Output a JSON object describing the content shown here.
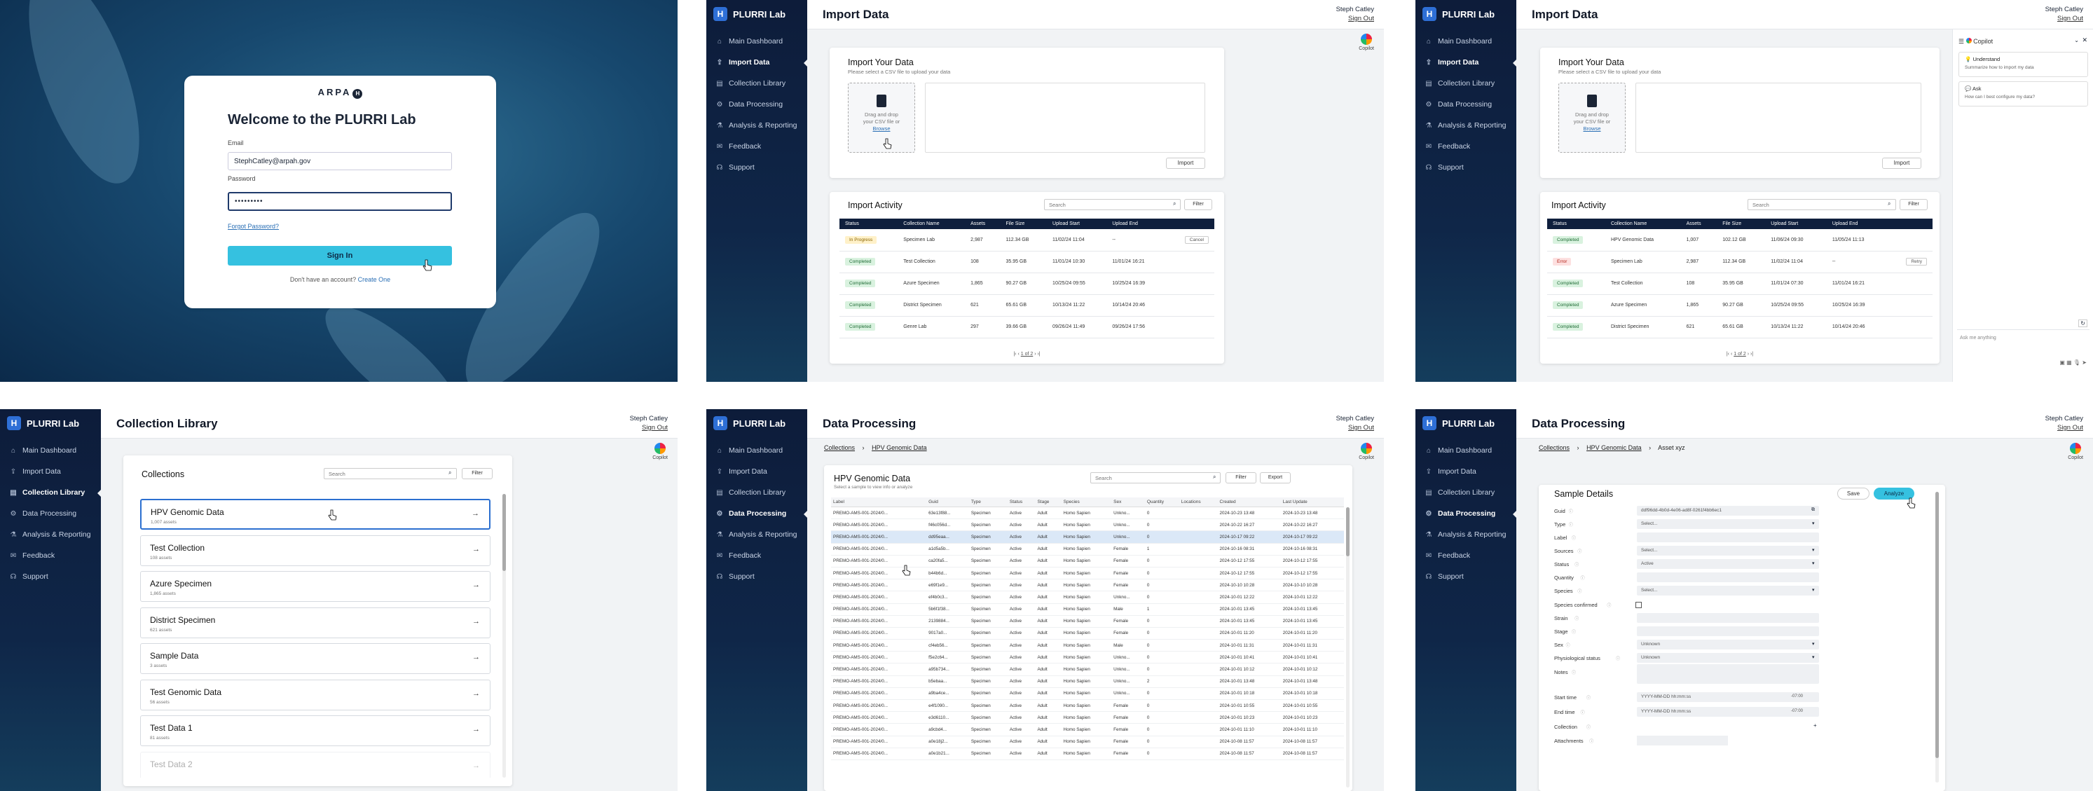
{
  "login": {
    "brand": "ARPA",
    "brand_mark": "H",
    "title": "Welcome to the PLURRI Lab",
    "email_label": "Email",
    "email_value": "StephCatley@arpah.gov",
    "password_label": "Password",
    "password_value": "•••••••••",
    "forgot": "Forgot Password?",
    "sign_in": "Sign In",
    "no_account": "Don't have an account?",
    "create": "Create One"
  },
  "app": {
    "name": "PLURRI Lab",
    "logo": "H",
    "user": "Steph Catley",
    "sign_out": "Sign Out",
    "copilot": "Copilot",
    "nav": [
      {
        "label": "Main Dashboard",
        "icon": "home-icon"
      },
      {
        "label": "Import Data",
        "icon": "upload-icon"
      },
      {
        "label": "Collection Library",
        "icon": "library-icon"
      },
      {
        "label": "Data Processing",
        "icon": "gear-icon"
      },
      {
        "label": "Analysis & Reporting",
        "icon": "chart-icon"
      },
      {
        "label": "Feedback",
        "icon": "feedback-icon"
      },
      {
        "label": "Support",
        "icon": "support-icon"
      }
    ]
  },
  "import": {
    "title": "Import Data",
    "card_title": "Import Your Data",
    "card_sub": "Please select a CSV file to upload your data",
    "drop_text": "Drag and drop your CSV file or",
    "browse": "Browse",
    "import_btn": "Import",
    "activity_title": "Import Activity",
    "search": "Search",
    "filter": "Filter",
    "headers": [
      "Status",
      "Collection Name",
      "Assets",
      "File Size",
      "Upload Start",
      "Upload End"
    ],
    "rows": [
      {
        "status": "In Progress",
        "kind": "prog",
        "name": "Specimen Lab",
        "assets": "2,987",
        "size": "112.34 GB",
        "start": "11/02/24 11:04",
        "end": "--",
        "action": "Cancel"
      },
      {
        "status": "Completed",
        "kind": "ok",
        "name": "Test Collection",
        "assets": "108",
        "size": "35.95 GB",
        "start": "11/01/24 10:30",
        "end": "11/01/24 16:21",
        "action": ""
      },
      {
        "status": "Completed",
        "kind": "ok",
        "name": "Azure Specimen",
        "assets": "1,865",
        "size": "90.27 GB",
        "start": "10/25/24 09:55",
        "end": "10/25/24 16:39",
        "action": ""
      },
      {
        "status": "Completed",
        "kind": "ok",
        "name": "District Specimen",
        "assets": "621",
        "size": "65.61 GB",
        "start": "10/13/24 11:22",
        "end": "10/14/24 20:46",
        "action": ""
      },
      {
        "status": "Completed",
        "kind": "ok",
        "name": "Genre Lab",
        "assets": "297",
        "size": "39.66 GB",
        "start": "09/26/24 11:49",
        "end": "09/26/24 17:56",
        "action": ""
      }
    ],
    "rows2": [
      {
        "status": "Completed",
        "kind": "ok",
        "name": "HPV Genomic Data",
        "assets": "1,007",
        "size": "102.12 GB",
        "start": "11/06/24 09:30",
        "end": "11/05/24 11:13",
        "action": ""
      },
      {
        "status": "Error",
        "kind": "err",
        "name": "Specimen Lab",
        "assets": "2,987",
        "size": "112.34 GB",
        "start": "11/02/24 11:04",
        "end": "--",
        "action": "Retry"
      },
      {
        "status": "Completed",
        "kind": "ok",
        "name": "Test Collection",
        "assets": "108",
        "size": "35.95 GB",
        "start": "11/01/24 07:30",
        "end": "11/01/24 16:21",
        "action": ""
      },
      {
        "status": "Completed",
        "kind": "ok",
        "name": "Azure Specimen",
        "assets": "1,865",
        "size": "90.27 GB",
        "start": "10/25/24 09:55",
        "end": "10/25/24 16:39",
        "action": ""
      },
      {
        "status": "Completed",
        "kind": "ok",
        "name": "District Specimen",
        "assets": "621",
        "size": "65.61 GB",
        "start": "10/13/24 11:22",
        "end": "10/14/24 20:46",
        "action": ""
      }
    ],
    "pager": "1 of 2"
  },
  "copilot_panel": {
    "title": "Copilot",
    "s1_title": "Understand",
    "s1_text": "Summarize how to import my data",
    "s2_title": "Ask",
    "s2_text": "How can I best configure my data?",
    "input": "Ask me anything"
  },
  "library": {
    "title": "Collection Library",
    "card_title": "Collections",
    "search": "Search",
    "filter": "Filter",
    "items": [
      {
        "name": "HPV Genomic Data",
        "sub": "1,007 assets"
      },
      {
        "name": "Test Collection",
        "sub": "108 assets"
      },
      {
        "name": "Azure Specimen",
        "sub": "1,865 assets"
      },
      {
        "name": "District Specimen",
        "sub": "621 assets"
      },
      {
        "name": "Sample Data",
        "sub": "3 assets"
      },
      {
        "name": "Test Genomic Data",
        "sub": "56 assets"
      },
      {
        "name": "Test Data 1",
        "sub": "81 assets"
      },
      {
        "name": "Test Data 2",
        "sub": ""
      }
    ]
  },
  "processing": {
    "title": "Data Processing",
    "crumb1": "Collections",
    "crumb2": "HPV Genomic Data",
    "crumb3": "Asset xyz",
    "table_title": "HPV Genomic Data",
    "table_sub": "Select a sample to view info or analyze",
    "search": "Search",
    "filter": "Filter",
    "export": "Export",
    "headers": [
      "Label",
      "Guid",
      "Type",
      "Status",
      "Stage",
      "Species",
      "Sex",
      "Quantity",
      "Locations",
      "Created",
      "Last Update"
    ],
    "rows": [
      [
        "PREMO-AMS-001-2024/0...",
        "63e13f88...",
        "Specimen",
        "Active",
        "Adult",
        "Homo Sapien",
        "Unkno...",
        "0",
        "",
        "2024-10-23 13:48",
        "2024-10-23 13:48"
      ],
      [
        "PREMO-AMS-001-2024/0...",
        "f46c056d...",
        "Specimen",
        "Active",
        "Adult",
        "Homo Sapien",
        "Unkno...",
        "0",
        "",
        "2024-10-22 16:27",
        "2024-10-22 16:27"
      ],
      [
        "PREMO-AMS-001-2024/0...",
        "dd95eaa...",
        "Specimen",
        "Active",
        "Adult",
        "Homo Sapien",
        "Unkno...",
        "0",
        "",
        "2024-10-17 09:22",
        "2024-10-17 09:22"
      ],
      [
        "PREMO-AMS-001-2024/0...",
        "a1d5a5b...",
        "Specimen",
        "Active",
        "Adult",
        "Homo Sapien",
        "Female",
        "1",
        "",
        "2024-10-16 08:31",
        "2024-10-16 08:31"
      ],
      [
        "PREMO-AMS-001-2024/0...",
        "ca20fa5...",
        "Specimen",
        "Active",
        "Adult",
        "Homo Sapien",
        "Female",
        "0",
        "",
        "2024-10-12 17:55",
        "2024-10-12 17:55"
      ],
      [
        "PREMO-AMS-001-2024/0...",
        "b44b6d...",
        "Specimen",
        "Active",
        "Adult",
        "Homo Sapien",
        "Female",
        "0",
        "",
        "2024-10-12 17:55",
        "2024-10-12 17:55"
      ],
      [
        "PREMO-AMS-001-2024/0...",
        "e69f1e9...",
        "Specimen",
        "Active",
        "Adult",
        "Homo Sapien",
        "Female",
        "0",
        "",
        "2024-10-10 10:28",
        "2024-10-10 10:28"
      ],
      [
        "PREMO-AMS-001-2024/0...",
        "ef4b0c3...",
        "Specimen",
        "Active",
        "Adult",
        "Homo Sapien",
        "Unkno...",
        "0",
        "",
        "2024-10-01 12:22",
        "2024-10-01 12:22"
      ],
      [
        "PREMO-AMS-001-2024/0...",
        "5b6f1f38...",
        "Specimen",
        "Active",
        "Adult",
        "Homo Sapien",
        "Male",
        "1",
        "",
        "2024-10-01 13:45",
        "2024-10-01 13:45"
      ],
      [
        "PREMO-AMS-001-2024/0...",
        "2139884...",
        "Specimen",
        "Active",
        "Adult",
        "Homo Sapien",
        "Female",
        "0",
        "",
        "2024-10-01 13:45",
        "2024-10-01 13:45"
      ],
      [
        "PREMO-AMS-001-2024/0...",
        "9017a0...",
        "Specimen",
        "Active",
        "Adult",
        "Homo Sapien",
        "Female",
        "0",
        "",
        "2024-10-01 11:20",
        "2024-10-01 11:20"
      ],
      [
        "PREMO-AMS-001-2024/0...",
        "cf4eb56...",
        "Specimen",
        "Active",
        "Adult",
        "Homo Sapien",
        "Male",
        "0",
        "",
        "2024-10-01 11:31",
        "2024-10-01 11:31"
      ],
      [
        "PREMO-AMS-001-2024/0...",
        "f5e2c64...",
        "Specimen",
        "Active",
        "Adult",
        "Homo Sapien",
        "Unkno...",
        "0",
        "",
        "2024-10-01 10:41",
        "2024-10-01 10:41"
      ],
      [
        "PREMO-AMS-001-2024/0...",
        "a95b734...",
        "Specimen",
        "Active",
        "Adult",
        "Homo Sapien",
        "Unkno...",
        "0",
        "",
        "2024-10-01 10:12",
        "2024-10-01 10:12"
      ],
      [
        "PREMO-AMS-001-2024/0...",
        "b5ebaa...",
        "Specimen",
        "Active",
        "Adult",
        "Homo Sapien",
        "Unkno...",
        "2",
        "",
        "2024-10-01 13:48",
        "2024-10-01 13:48"
      ],
      [
        "PREMO-AMS-001-2024/0...",
        "a9ba4ce...",
        "Specimen",
        "Active",
        "Adult",
        "Homo Sapien",
        "Unkno...",
        "0",
        "",
        "2024-10-01 10:18",
        "2024-10-01 10:18"
      ],
      [
        "PREMO-AMS-001-2024/0...",
        "e4f1090...",
        "Specimen",
        "Active",
        "Adult",
        "Homo Sapien",
        "Female",
        "0",
        "",
        "2024-10-01 10:55",
        "2024-10-01 10:55"
      ],
      [
        "PREMO-AMS-001-2024/0...",
        "e3d6110...",
        "Specimen",
        "Active",
        "Adult",
        "Homo Sapien",
        "Female",
        "0",
        "",
        "2024-10-01 10:23",
        "2024-10-01 10:23"
      ],
      [
        "PREMO-AMS-001-2024/0...",
        "a9cbd4...",
        "Specimen",
        "Active",
        "Adult",
        "Homo Sapien",
        "Female",
        "0",
        "",
        "2024-10-01 11:10",
        "2024-10-01 11:10"
      ],
      [
        "PREMO-AMS-001-2024/0...",
        "a0e18j2...",
        "Specimen",
        "Active",
        "Adult",
        "Homo Sapien",
        "Female",
        "0",
        "",
        "2024-10-08 11:57",
        "2024-10-08 11:57"
      ],
      [
        "PREMO-AMS-001-2024/0...",
        "a0e1b21...",
        "Specimen",
        "Active",
        "Adult",
        "Homo Sapien",
        "Female",
        "0",
        "",
        "2024-10-08 11:57",
        "2024-10-08 11:57"
      ]
    ]
  },
  "details": {
    "title": "Sample Details",
    "save": "Save",
    "analyze": "Analyze",
    "guid": "ddf96dd-4b0d-4e06-ad8f-0261f4bb6ec1",
    "fields": [
      {
        "label": "Guid",
        "value": "ddf96dd-4b0d-4e06-ad8f-0261f4bb6ec1"
      },
      {
        "label": "Type",
        "value": "Select..."
      },
      {
        "label": "Label",
        "value": ""
      },
      {
        "label": "Sources",
        "value": "Select..."
      },
      {
        "label": "Status",
        "value": "Active"
      },
      {
        "label": "Quantity",
        "value": ""
      },
      {
        "label": "Species",
        "value": "Select..."
      },
      {
        "label": "Species confirmed",
        "value": ""
      },
      {
        "label": "Strain",
        "value": ""
      },
      {
        "label": "Stage",
        "value": ""
      },
      {
        "label": "Sex",
        "value": "Unknown"
      },
      {
        "label": "Physiological status",
        "value": "Unknown"
      },
      {
        "label": "Notes",
        "value": ""
      },
      {
        "label": "Start time",
        "value": "YYYY-MM-DD hh:mm:ss"
      },
      {
        "label": "End time",
        "value": "YYYY-MM-DD hh:mm:ss"
      },
      {
        "label": "Collection",
        "value": ""
      },
      {
        "label": "Attachments",
        "value": ""
      }
    ],
    "tz": "-07:00"
  }
}
